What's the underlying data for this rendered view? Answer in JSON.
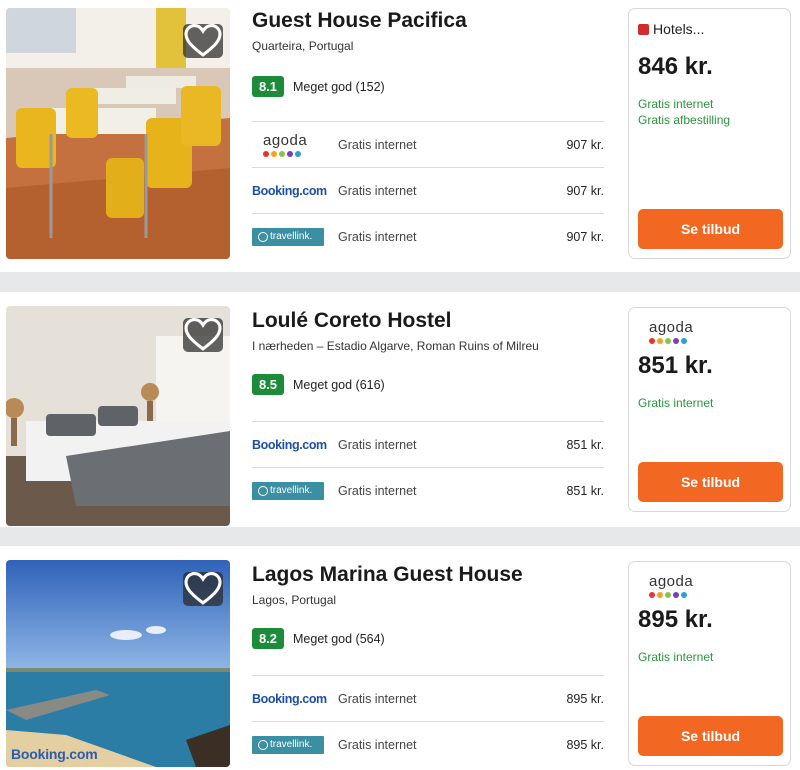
{
  "colors": {
    "score_bg": "#1c8c3a",
    "cta_bg": "#f26722",
    "perk_green": "#27963c",
    "booking_blue": "#1d4fa8"
  },
  "hotels": [
    {
      "name": "Guest House Pacifica",
      "location": "Quarteira, Portugal",
      "score": "8.1",
      "rating_label": "Meget god (152)",
      "offers": [
        {
          "provider": "agoda",
          "perk": "Gratis internet",
          "price": "907 kr."
        },
        {
          "provider": "Booking.com",
          "perk": "Gratis internet",
          "price": "907 kr."
        },
        {
          "provider": "travellink.",
          "perk": "Gratis internet",
          "price": "907 kr."
        }
      ],
      "best": {
        "provider": "Hotels...",
        "price": "846 kr.",
        "perks": [
          "Gratis internet",
          "Gratis afbestilling"
        ],
        "cta": "Se tilbud"
      },
      "photo_brand": ""
    },
    {
      "name": "Loulé Coreto Hostel",
      "location": "I nærheden – Estadio Algarve, Roman Ruins of Milreu",
      "score": "8.5",
      "rating_label": "Meget god (616)",
      "offers": [
        {
          "provider": "Booking.com",
          "perk": "Gratis internet",
          "price": "851 kr."
        },
        {
          "provider": "travellink.",
          "perk": "Gratis internet",
          "price": "851 kr."
        }
      ],
      "best": {
        "provider": "agoda",
        "price": "851 kr.",
        "perks": [
          "Gratis internet"
        ],
        "cta": "Se tilbud"
      },
      "photo_brand": ""
    },
    {
      "name": "Lagos Marina Guest House",
      "location": "Lagos, Portugal",
      "score": "8.2",
      "rating_label": "Meget god (564)",
      "offers": [
        {
          "provider": "Booking.com",
          "perk": "Gratis internet",
          "price": "895 kr."
        },
        {
          "provider": "travellink.",
          "perk": "Gratis internet",
          "price": "895 kr."
        }
      ],
      "best": {
        "provider": "agoda",
        "price": "895 kr.",
        "perks": [
          "Gratis internet"
        ],
        "cta": "Se tilbud"
      },
      "photo_brand": "Booking.com"
    }
  ],
  "icons": {
    "favorite": "heart-icon",
    "hotels_logo": "hotels-logo-icon",
    "travellink_logo": "travellink-logo-icon",
    "agoda_logo": "agoda-logo-icon"
  }
}
